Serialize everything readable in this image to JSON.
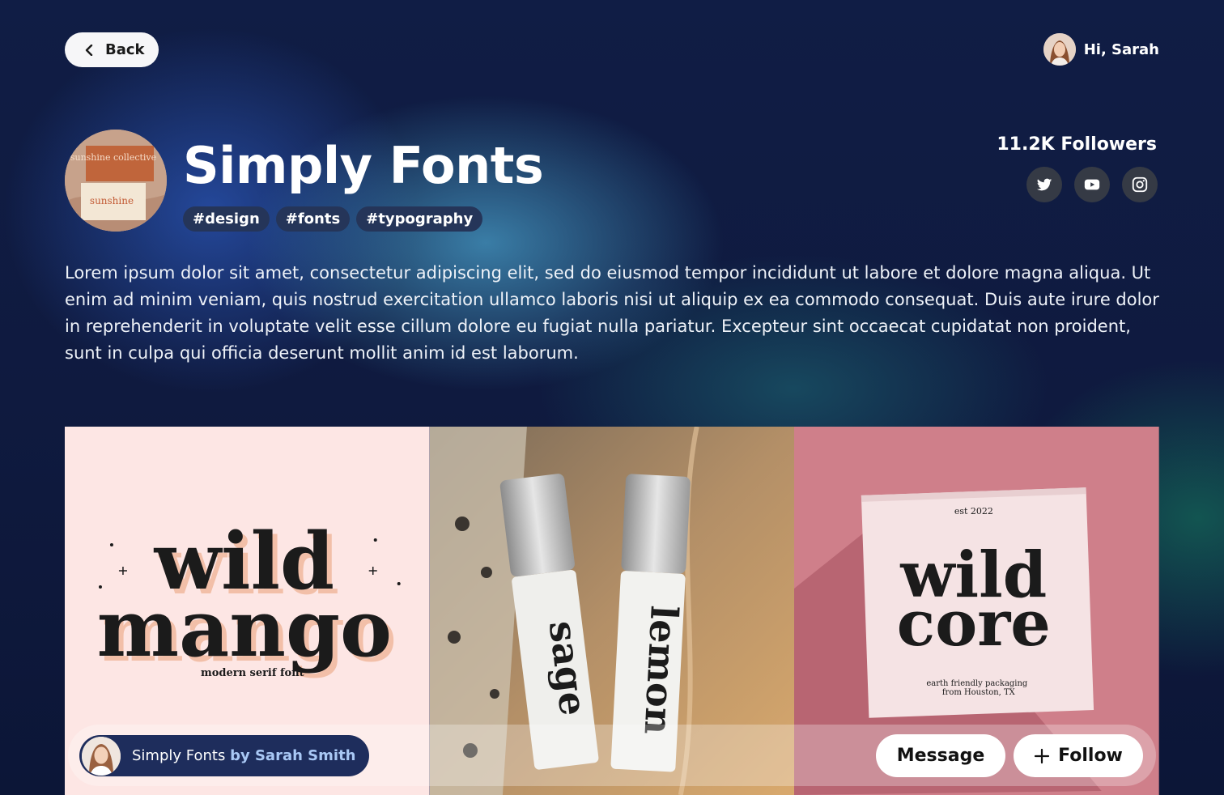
{
  "nav": {
    "back_label": "Back",
    "greeting": "Hi, Sarah"
  },
  "profile": {
    "avatar_label": "sunshine collective",
    "title": "Simply Fonts",
    "tags": [
      "#design",
      "#fonts",
      "#typography"
    ],
    "followers": "11.2K Followers",
    "socials": [
      "twitter-icon",
      "youtube-icon",
      "instagram-icon"
    ],
    "description": "Lorem ipsum dolor sit amet, consectetur adipiscing elit, sed do eiusmod tempor incididunt ut labore et dolore magna aliqua. Ut enim ad minim veniam, quis nostrud exercitation ullamco laboris nisi ut aliquip ex ea commodo consequat. Duis aute irure dolor in reprehenderit in voluptate velit esse cillum dolore eu fugiat nulla pariatur. Excepteur sint occaecat cupidatat non proident, sunt in culpa qui officia deserunt mollit anim id est laborum."
  },
  "gallery": {
    "panel1": {
      "line1": "wild",
      "line2": "mango",
      "sub": "modern serif font"
    },
    "panel2": {
      "bottle1": "sage",
      "bottle2": "lemon"
    },
    "panel3": {
      "est": "est 2022",
      "line1": "wild",
      "line2": "core",
      "sub1": "earth friendly packaging",
      "sub2": "from Houston, TX"
    }
  },
  "author": {
    "name": "Simply Fonts",
    "by": "by Sarah Smith"
  },
  "actions": {
    "message_label": "Message",
    "follow_label": "Follow"
  },
  "colors": {
    "tag_bg": "#253559",
    "pill_bg": "#1e2d5c",
    "social_bg": "#353a45"
  }
}
